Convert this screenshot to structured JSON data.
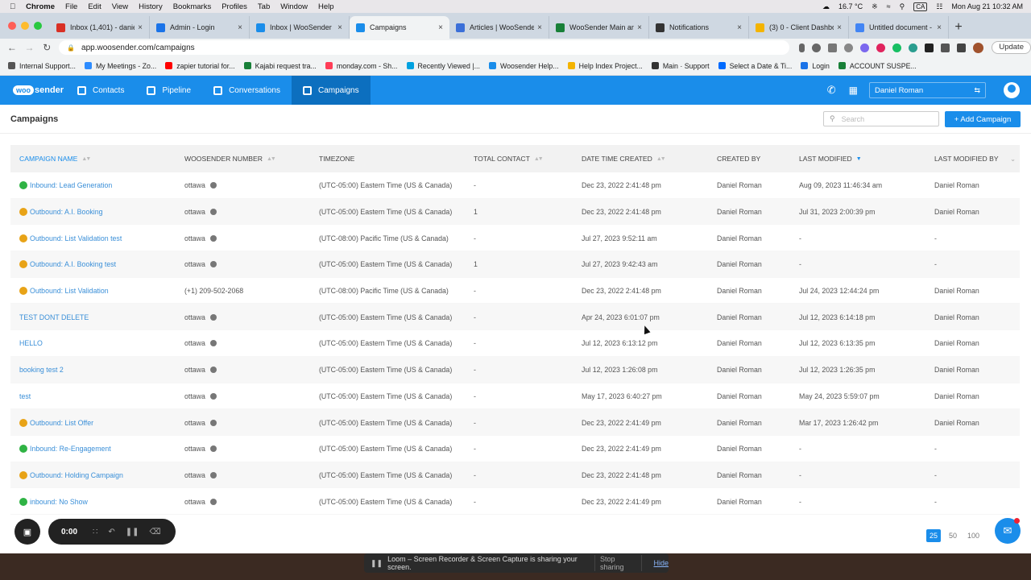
{
  "menubar": {
    "items": [
      "Chrome",
      "File",
      "Edit",
      "View",
      "History",
      "Bookmarks",
      "Profiles",
      "Tab",
      "Window",
      "Help"
    ],
    "temperature": "16.7 °C",
    "lang": "CA",
    "datetime": "Mon Aug 21  10:32 AM"
  },
  "tabs": [
    {
      "title": "Inbox (1,401) - daniel",
      "color": "#d93025"
    },
    {
      "title": "Admin - Login",
      "color": "#1a73e8"
    },
    {
      "title": "Inbox | WooSender | ",
      "color": "#1a8dea"
    },
    {
      "title": "Campaigns",
      "color": "#1a8dea",
      "active": true
    },
    {
      "title": "Articles | WooSender",
      "color": "#3b6fd8"
    },
    {
      "title": "WooSender Main and",
      "color": "#188038"
    },
    {
      "title": "Notifications",
      "color": "#333"
    },
    {
      "title": "(3) 0 - Client Dashbo",
      "color": "#f4b400"
    },
    {
      "title": "Untitled document -",
      "color": "#4285f4"
    }
  ],
  "address": {
    "url": "app.woosender.com/campaigns",
    "update_label": "Update"
  },
  "bookmarks": [
    {
      "label": "Internal Support...",
      "color": "#555"
    },
    {
      "label": "My Meetings - Zo...",
      "color": "#2d8cff"
    },
    {
      "label": "zapier tutorial for...",
      "color": "#ff0000"
    },
    {
      "label": "Kajabi request tra...",
      "color": "#188038"
    },
    {
      "label": "monday.com - Sh...",
      "color": "#ff3d57"
    },
    {
      "label": "Recently Viewed |...",
      "color": "#00a1e0"
    },
    {
      "label": "Woosender Help...",
      "color": "#1a8dea"
    },
    {
      "label": "Help Index Project...",
      "color": "#f4b400"
    },
    {
      "label": "Main · Support",
      "color": "#333"
    },
    {
      "label": "Select a Date & Ti...",
      "color": "#006bff"
    },
    {
      "label": "Login",
      "color": "#1a73e8"
    },
    {
      "label": "ACCOUNT SUSPE...",
      "color": "#188038"
    }
  ],
  "nav": {
    "logo": "woosender",
    "logo_prefix": "woo",
    "logo_suffix": "sender",
    "items": [
      "Contacts",
      "Pipeline",
      "Conversations",
      "Campaigns"
    ],
    "active": "Campaigns",
    "user": "Daniel Roman"
  },
  "page": {
    "title": "Campaigns",
    "search_placeholder": "Search",
    "add_label": "+ Add Campaign"
  },
  "table": {
    "columns": [
      "CAMPAIGN NAME",
      "WOOSENDER NUMBER",
      "TIMEZONE",
      "TOTAL CONTACT",
      "DATE TIME CREATED",
      "CREATED BY",
      "LAST MODIFIED",
      "LAST MODIFIED BY"
    ],
    "rows": [
      {
        "status": "green",
        "name": "Inbound: Lead Generation",
        "number": "ottawa",
        "tz": "(UTC-05:00) Eastern Time (US & Canada)",
        "total": "-",
        "created": "Dec 23, 2022 2:41:48 pm",
        "by": "Daniel Roman",
        "modified": "Aug 09, 2023 11:46:34 am",
        "mod_by": "Daniel Roman"
      },
      {
        "status": "orange",
        "name": "Outbound: A.I. Booking",
        "number": "ottawa",
        "tz": "(UTC-05:00) Eastern Time (US & Canada)",
        "total": "1",
        "created": "Dec 23, 2022 2:41:48 pm",
        "by": "Daniel Roman",
        "modified": "Jul 31, 2023 2:00:39 pm",
        "mod_by": "Daniel Roman"
      },
      {
        "status": "orange",
        "name": "Outbound: List Validation test",
        "number": "ottawa",
        "tz": "(UTC-08:00) Pacific Time (US & Canada)",
        "total": "-",
        "created": "Jul 27, 2023 9:52:11 am",
        "by": "Daniel Roman",
        "modified": "-",
        "mod_by": "-"
      },
      {
        "status": "orange",
        "name": "Outbound: A.I. Booking test",
        "number": "ottawa",
        "tz": "(UTC-05:00) Eastern Time (US & Canada)",
        "total": "1",
        "created": "Jul 27, 2023 9:42:43 am",
        "by": "Daniel Roman",
        "modified": "-",
        "mod_by": "-"
      },
      {
        "status": "orange",
        "name": "Outbound: List Validation",
        "number": "(+1) 209-502-2068",
        "tz": "(UTC-08:00) Pacific Time (US & Canada)",
        "total": "-",
        "created": "Dec 23, 2022 2:41:48 pm",
        "by": "Daniel Roman",
        "modified": "Jul 24, 2023 12:44:24 pm",
        "mod_by": "Daniel Roman"
      },
      {
        "status": "none",
        "name": "TEST DONT DELETE",
        "number": "ottawa",
        "tz": "(UTC-05:00) Eastern Time (US & Canada)",
        "total": "-",
        "created": "Apr 24, 2023 6:01:07 pm",
        "by": "Daniel Roman",
        "modified": "Jul 12, 2023 6:14:18 pm",
        "mod_by": "Daniel Roman"
      },
      {
        "status": "none",
        "name": "HELLO",
        "number": "ottawa",
        "tz": "(UTC-05:00) Eastern Time (US & Canada)",
        "total": "-",
        "created": "Jul 12, 2023 6:13:12 pm",
        "by": "Daniel Roman",
        "modified": "Jul 12, 2023 6:13:35 pm",
        "mod_by": "Daniel Roman"
      },
      {
        "status": "none",
        "name": "booking test 2",
        "number": "ottawa",
        "tz": "(UTC-05:00) Eastern Time (US & Canada)",
        "total": "-",
        "created": "Jul 12, 2023 1:26:08 pm",
        "by": "Daniel Roman",
        "modified": "Jul 12, 2023 1:26:35 pm",
        "mod_by": "Daniel Roman"
      },
      {
        "status": "none",
        "name": "test",
        "number": "ottawa",
        "tz": "(UTC-05:00) Eastern Time (US & Canada)",
        "total": "-",
        "created": "May 17, 2023 6:40:27 pm",
        "by": "Daniel Roman",
        "modified": "May 24, 2023 5:59:07 pm",
        "mod_by": "Daniel Roman"
      },
      {
        "status": "orange",
        "name": "Outbound: List Offer",
        "number": "ottawa",
        "tz": "(UTC-05:00) Eastern Time (US & Canada)",
        "total": "-",
        "created": "Dec 23, 2022 2:41:49 pm",
        "by": "Daniel Roman",
        "modified": "Mar 17, 2023 1:26:42 pm",
        "mod_by": "Daniel Roman"
      },
      {
        "status": "green",
        "name": "Inbound: Re-Engagement",
        "number": "ottawa",
        "tz": "(UTC-05:00) Eastern Time (US & Canada)",
        "total": "-",
        "created": "Dec 23, 2022 2:41:49 pm",
        "by": "Daniel Roman",
        "modified": "-",
        "mod_by": "-"
      },
      {
        "status": "orange",
        "name": "Outbound: Holding Campaign",
        "number": "ottawa",
        "tz": "(UTC-05:00) Eastern Time (US & Canada)",
        "total": "-",
        "created": "Dec 23, 2022 2:41:48 pm",
        "by": "Daniel Roman",
        "modified": "-",
        "mod_by": "-"
      },
      {
        "status": "green",
        "name": "inbound: No Show",
        "number": "ottawa",
        "tz": "(UTC-05:00) Eastern Time (US & Canada)",
        "total": "-",
        "created": "Dec 23, 2022 2:41:49 pm",
        "by": "Daniel Roman",
        "modified": "-",
        "mod_by": "-"
      }
    ]
  },
  "pagination": {
    "sizes": [
      "25",
      "50",
      "100"
    ],
    "selected": "25"
  },
  "recorder": {
    "time": "0:00"
  },
  "loom": {
    "message": "Loom – Screen Recorder & Screen Capture is sharing your screen.",
    "stop": "Stop sharing",
    "hide": "Hide"
  },
  "colors": {
    "brand": "#1a8dea",
    "status_green": "#2fb344",
    "status_orange": "#e8a317"
  }
}
